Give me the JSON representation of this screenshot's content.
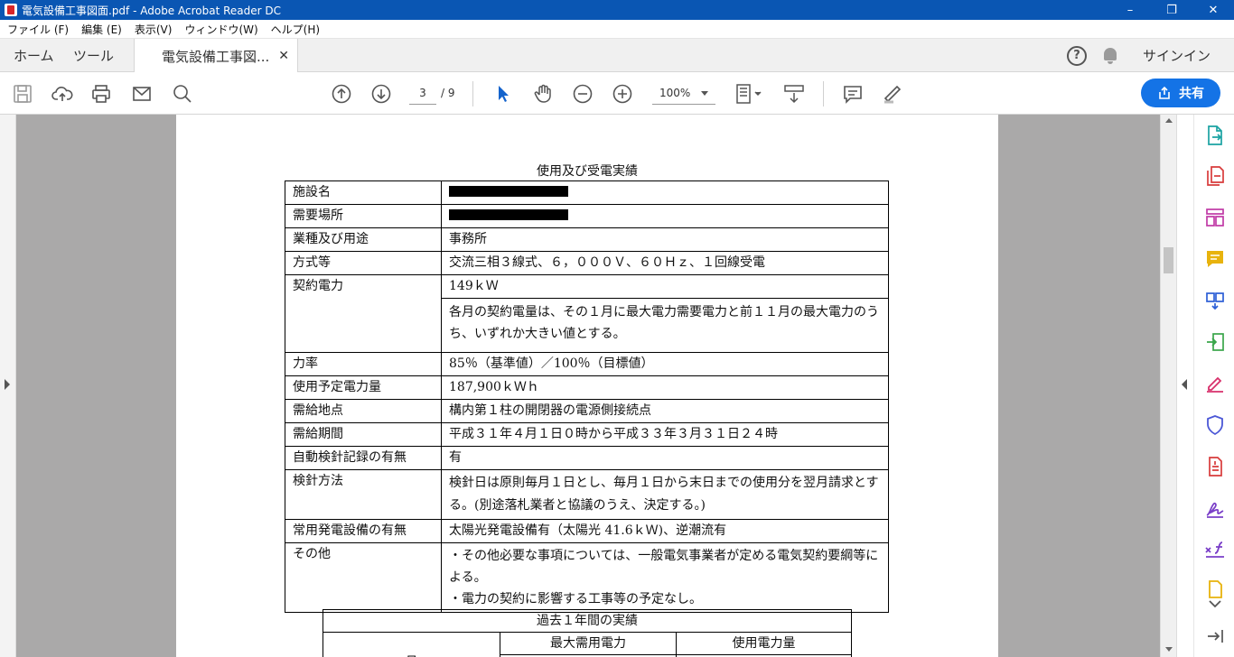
{
  "window": {
    "title": "電気設備工事図面.pdf - Adobe Acrobat Reader DC"
  },
  "menu": [
    "ファイル (F)",
    "編集 (E)",
    "表示(V)",
    "ウィンドウ(W)",
    "ヘルプ(H)"
  ],
  "tabs": {
    "home": "ホーム",
    "tools": "ツール",
    "document": "電気設備工事図...",
    "signin": "サインイン"
  },
  "toolbar": {
    "page_current": "3",
    "page_total": "/ 9",
    "zoom": "100%",
    "share_label": "共有"
  },
  "doc": {
    "heading": "使用及び受電実績",
    "rows": [
      {
        "label": "施設名",
        "value": ""
      },
      {
        "label": "需要場所",
        "value": ""
      },
      {
        "label": "業種及び用途",
        "value": "事務所"
      },
      {
        "label": "方式等",
        "value": "交流三相３線式、６，０００Ｖ、６０Ｈｚ、１回線受電"
      },
      {
        "label": "契約電力",
        "value": "149ｋＷ",
        "note": "各月の契約電量は、その１月に最大電力需要電力と前１１月の最大電力のうち、いずれか大きい値とする。"
      },
      {
        "label": "力率",
        "value": "85％（基準値）／100％（目標値）"
      },
      {
        "label": "使用予定電力量",
        "value": "187,900ｋＷｈ"
      },
      {
        "label": "需給地点",
        "value": "構内第１柱の開閉器の電源側接続点"
      },
      {
        "label": "需給期間",
        "value": "平成３１年４月１日０時から平成３３年３月３１日２４時"
      },
      {
        "label": "自動検針記録の有無",
        "value": "有"
      },
      {
        "label": "検針方法",
        "value": "検針日は原則毎月１日とし、毎月１日から末日までの使用分を翌月請求とする。(別途落札業者と協議のうえ、決定する。)"
      },
      {
        "label": "常用発電設備の有無",
        "value": "太陽光発電設備有（太陽光 41.6ｋＷ)、逆潮流有"
      },
      {
        "label": "その他",
        "lines": [
          "・その他必要な事項については、一般電気事業者が定める電気契約要綱等による。",
          "・電力の契約に影響する工事等の予定なし。"
        ]
      }
    ],
    "past": {
      "title": "過去１年間の実績",
      "headers": [
        "月",
        "最大需用電力",
        "使用電力量"
      ]
    }
  }
}
